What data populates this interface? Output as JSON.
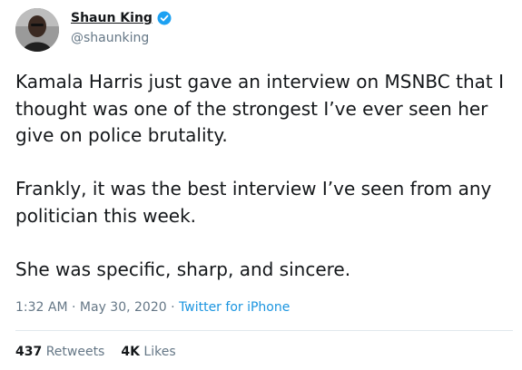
{
  "author": {
    "display_name": "Shaun King",
    "handle": "@shaunking",
    "verified": true,
    "avatar_icon": "user-avatar-photo",
    "verified_icon": "verified-badge-icon"
  },
  "tweet": {
    "paragraphs": [
      "Kamala Harris just gave an interview on MSNBC that I thought was one of the strongest I’ve ever seen her give on police brutality.",
      "Frankly, it was the best interview I’ve seen from any politician this week.",
      "She was specific, sharp, and sincere."
    ],
    "time": "1:32 AM",
    "date": "May 30, 2020",
    "separator": "·",
    "source": "Twitter for iPhone"
  },
  "stats": {
    "retweets_count": "437",
    "retweets_label": "Retweets",
    "likes_count": "4K",
    "likes_label": "Likes"
  },
  "colors": {
    "text": "#14171a",
    "secondary": "#657786",
    "link": "#1b95e0",
    "divider": "#e1e8ed",
    "verified": "#1da1f2"
  }
}
